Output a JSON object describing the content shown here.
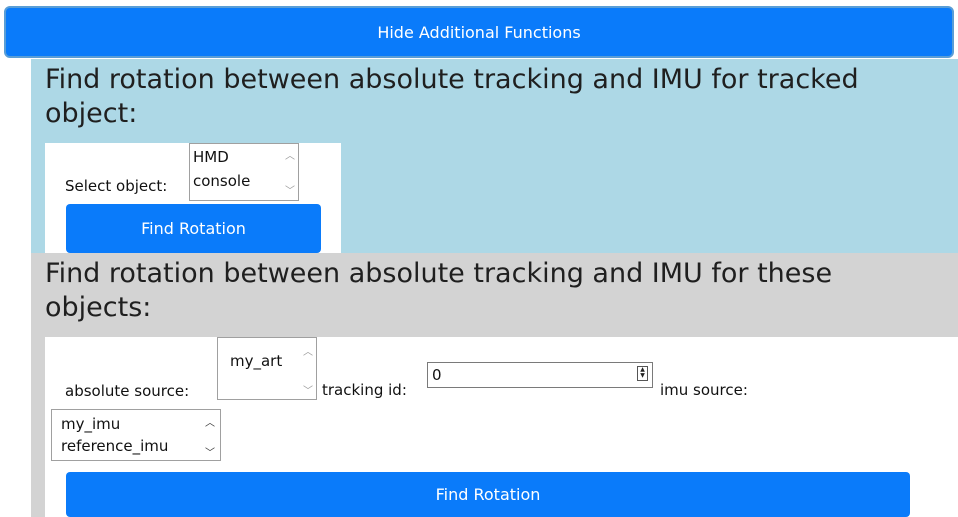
{
  "toggle_button": {
    "label": "Hide Additional Functions"
  },
  "section_tracked": {
    "heading": "Find rotation between absolute tracking and IMU for tracked object:",
    "select_label": "Select object:",
    "options": [
      "HMD",
      "console"
    ],
    "button_label": "Find Rotation"
  },
  "section_objects": {
    "heading": "Find rotation between absolute tracking and IMU for these objects:",
    "absolute_source_label": "absolute source:",
    "absolute_source_options": [
      "my_art"
    ],
    "tracking_id_label": "tracking id:",
    "tracking_id_value": "0",
    "imu_source_label": "imu source:",
    "imu_source_options": [
      "my_imu",
      "reference_imu"
    ],
    "button_label": "Find Rotation"
  },
  "colors": {
    "accent": "#0a7bfa",
    "panel_blue": "#add8e6",
    "panel_gray": "#d3d3d3"
  }
}
